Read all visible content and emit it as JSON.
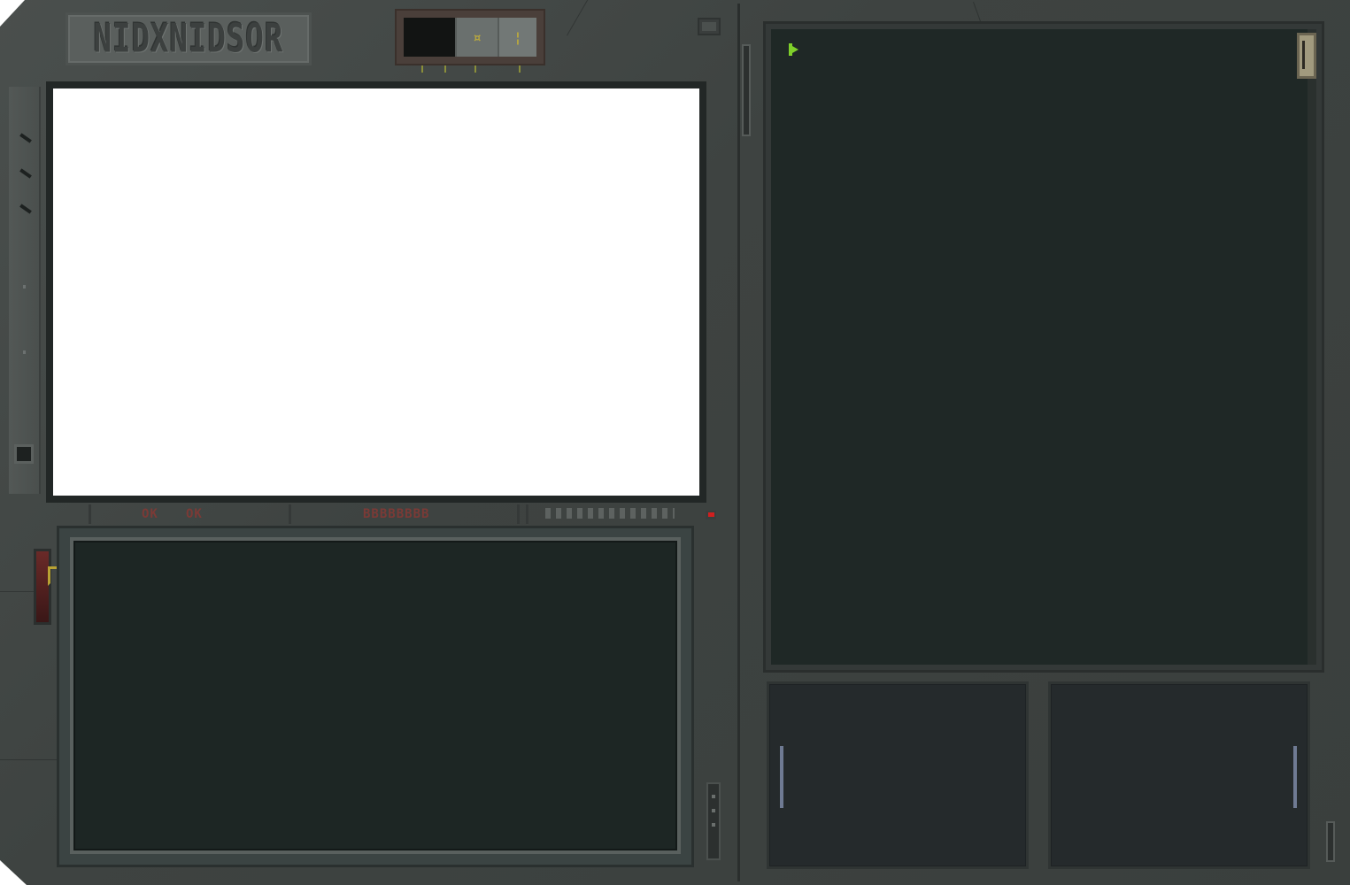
{
  "device": {
    "brand_label": "NIDXNIDSOR",
    "body_color": "#3e4341",
    "screen_color": "#1f2826",
    "alert_color": "#d11f1f"
  },
  "top_switch": {
    "button_a_glyph": "¤",
    "button_b_glyph": "¦"
  },
  "status_strip": {
    "label_a": "OK",
    "label_b": "OK",
    "label_c": "BBBBBBBB",
    "alert_led": "on"
  },
  "right_terminal": {
    "cursor_glyph": "▶",
    "cursor_color": "#7fd02a"
  },
  "sub_panels": {
    "left_level_color": "#6f7a93",
    "right_level_color": "#6f7a93"
  },
  "icons": [
    "logo-plate",
    "power-switch",
    "corner-button",
    "side-rail",
    "ejector-lever",
    "cursor-icon",
    "scroll-handle",
    "alert-led"
  ]
}
